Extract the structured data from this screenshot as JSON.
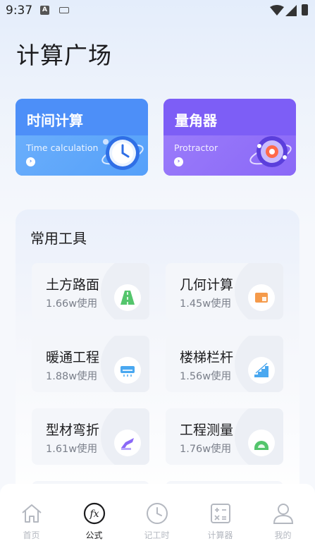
{
  "status_bar": {
    "time": "9:37"
  },
  "page": {
    "title": "计算广场"
  },
  "feature_cards": [
    {
      "title": "时间计算",
      "subtitle": "Time calculation",
      "icon": "clock-icon"
    },
    {
      "title": "量角器",
      "subtitle": "Protractor",
      "icon": "protractor-icon"
    }
  ],
  "tools": {
    "title": "常用工具",
    "items": [
      {
        "name": "土方路面",
        "usage": "1.66w使用",
        "icon": "road-icon",
        "color": "#54c56c"
      },
      {
        "name": "几何计算",
        "usage": "1.45w使用",
        "icon": "cube-icon",
        "color": "#f59a4a"
      },
      {
        "name": "暖通工程",
        "usage": "1.88w使用",
        "icon": "air-conditioner-icon",
        "color": "#4aa8f0"
      },
      {
        "name": "楼梯栏杆",
        "usage": "1.56w使用",
        "icon": "stairs-icon",
        "color": "#4aa8f0"
      },
      {
        "name": "型材弯折",
        "usage": "1.61w使用",
        "icon": "bending-icon",
        "color": "#8a68f7"
      },
      {
        "name": "工程测量",
        "usage": "1.76w使用",
        "icon": "measure-icon",
        "color": "#54c56c"
      }
    ]
  },
  "tabbar": {
    "active": "公式",
    "items": [
      {
        "label": "首页",
        "icon": "home-icon"
      },
      {
        "label": "公式",
        "icon": "formula-icon"
      },
      {
        "label": "记工时",
        "icon": "clock-icon"
      },
      {
        "label": "计算器",
        "icon": "calculator-icon"
      },
      {
        "label": "我的",
        "icon": "user-icon"
      }
    ]
  }
}
